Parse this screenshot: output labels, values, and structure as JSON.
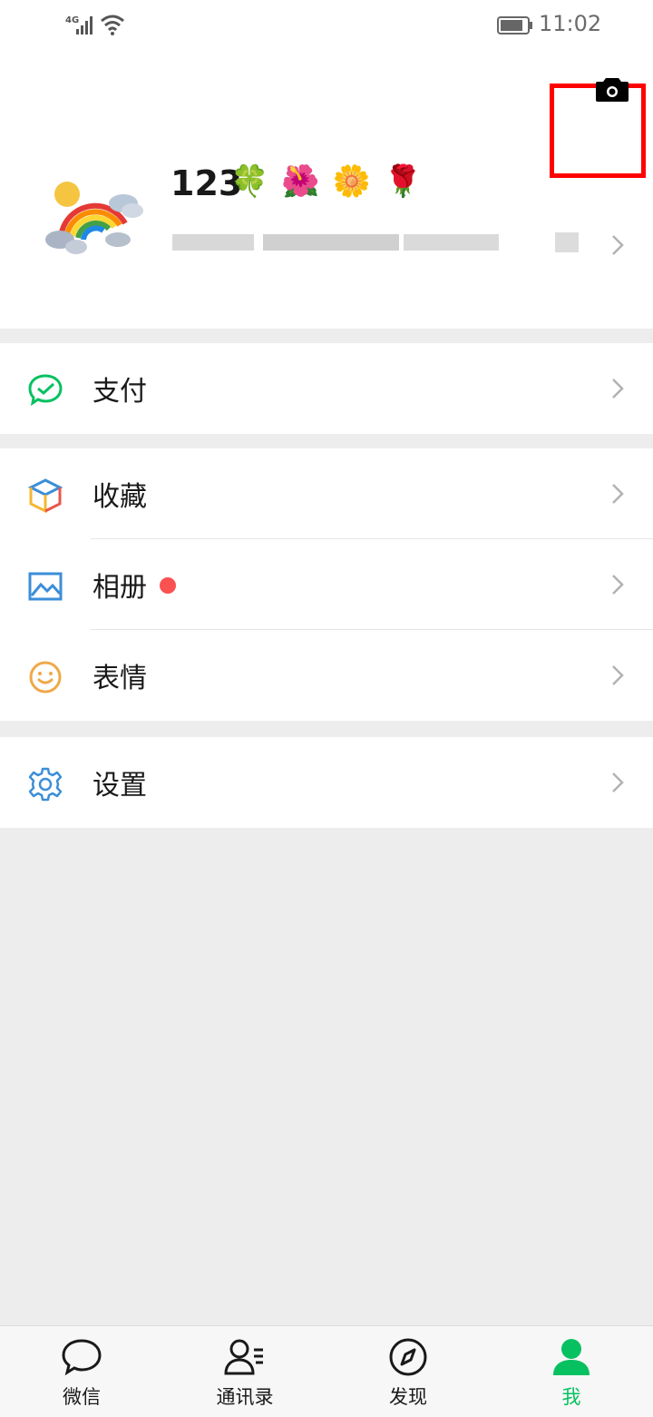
{
  "status_bar": {
    "network": "4G",
    "time": "11:02"
  },
  "profile": {
    "nickname": "123",
    "emojis": [
      "🍀",
      "🌺",
      "🌼",
      "🌹"
    ]
  },
  "menu": {
    "pay": "支付",
    "favorites": "收藏",
    "album": "相册",
    "stickers": "表情",
    "settings": "设置"
  },
  "tabbar": {
    "chats": "微信",
    "contacts": "通讯录",
    "discover": "发现",
    "me": "我"
  },
  "colors": {
    "accent": "#07c160",
    "badge": "#fa5151",
    "highlight": "#ff0000"
  }
}
